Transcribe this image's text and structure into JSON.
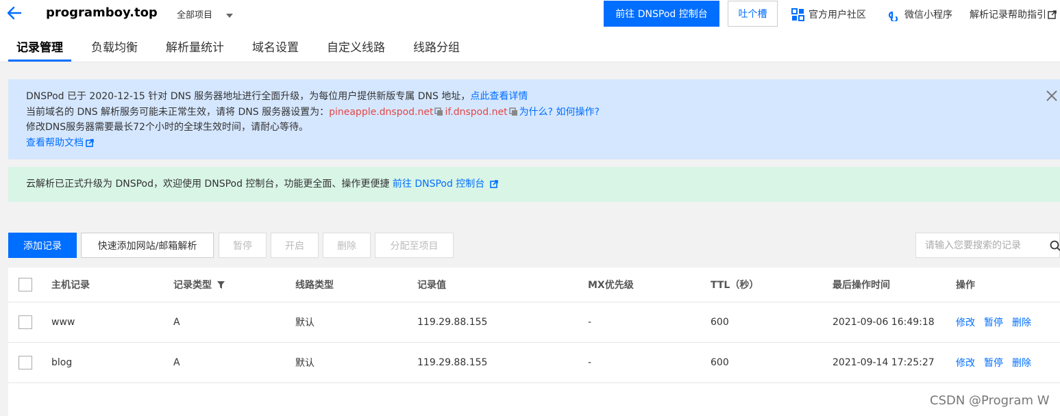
{
  "header": {
    "domain": "programboy.top",
    "project": "全部项目",
    "dnspod_button": "前往 DNSPod 控制台",
    "feedback_button": "吐个槽",
    "links": [
      "官方用户社区",
      "微信小程序",
      "解析记录帮助指引"
    ]
  },
  "tabs": [
    "记录管理",
    "负载均衡",
    "解析量统计",
    "域名设置",
    "自定义线路",
    "线路分组"
  ],
  "notice_blue": {
    "line1_text": "DNSPod 已于 2020-12-15 针对 DNS 服务器地址进行全面升级，为每位用户提供新版专属 DNS 地址，",
    "line1_link": "点此查看详情",
    "line2_text": "当前域名的 DNS 解析服务可能未正常生效，请将 DNS 服务器设置为：",
    "ns1": "pineapple.dnspod.net",
    "ns2": "if.dnspod.net",
    "line2_link": "为什么? 如何操作?",
    "line3_text": "修改DNS服务器需要最长72个小时的全球生效时间，请耐心等待。",
    "help_link": "查看帮助文档"
  },
  "notice_green": {
    "text": "云解析已正式升级为 DNSPod，欢迎使用 DNSPod 控制台，功能更全面、操作更便捷 ",
    "link": "前往 DNSPod 控制台"
  },
  "toolbar": {
    "add": "添加记录",
    "quick_add": "快速添加网站/邮箱解析",
    "pause": "暂停",
    "enable": "开启",
    "delete": "删除",
    "assign": "分配至项目",
    "search_placeholder": "请输入您要搜索的记录"
  },
  "table": {
    "headers": [
      "主机记录",
      "记录类型",
      "线路类型",
      "记录值",
      "MX优先级",
      "TTL（秒）",
      "最后操作时间",
      "操作"
    ],
    "rows": [
      {
        "host": "www",
        "type": "A",
        "line": "默认",
        "value": "119.29.88.155",
        "mx": "-",
        "ttl": "600",
        "time": "2021-09-06 16:49:18"
      },
      {
        "host": "blog",
        "type": "A",
        "line": "默认",
        "value": "119.29.88.155",
        "mx": "-",
        "ttl": "600",
        "time": "2021-09-14 17:25:27"
      }
    ],
    "ops": [
      "修改",
      "暂停",
      "删除"
    ]
  },
  "watermark": "CSDN @Program W",
  "colors": {
    "primary": "#006eff",
    "info_bg": "#d5e7ff",
    "success_bg": "#d8f5e6",
    "nameserver": "#e54545"
  }
}
